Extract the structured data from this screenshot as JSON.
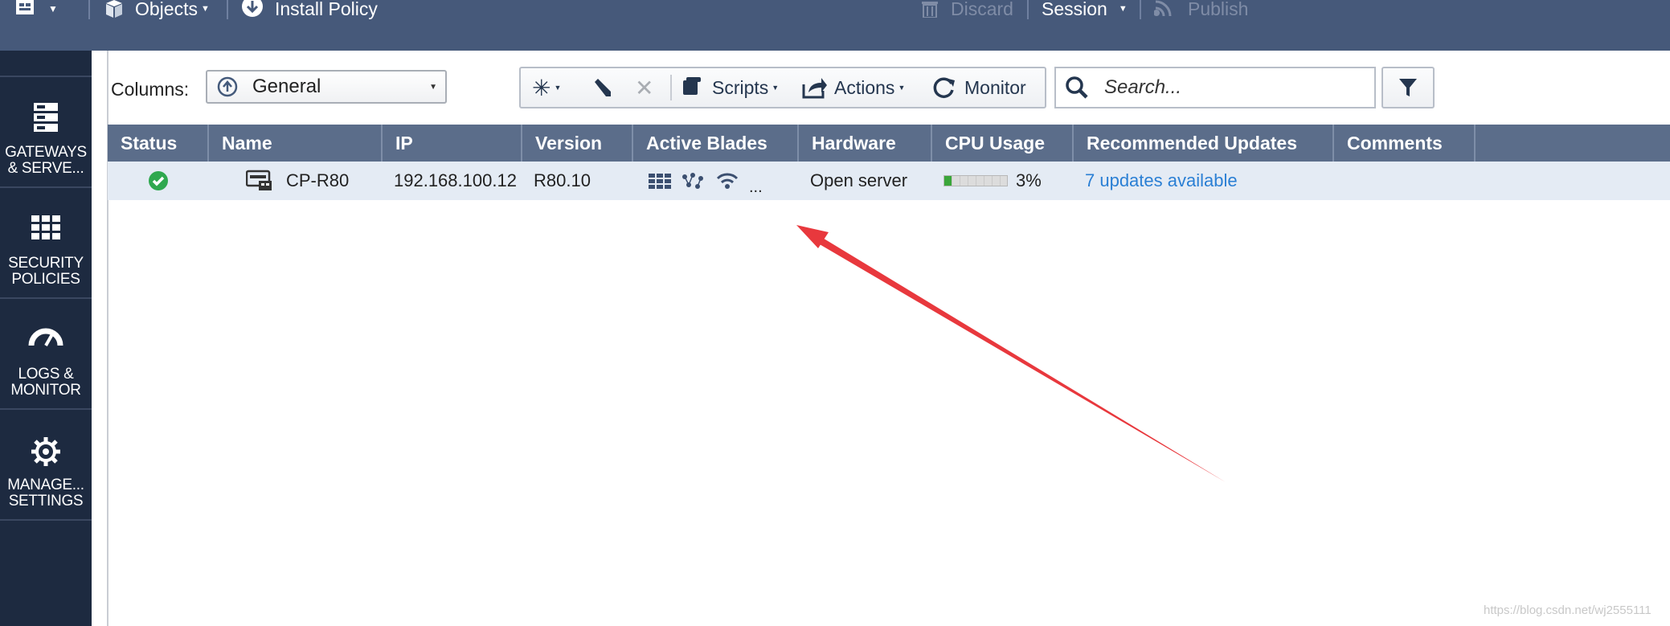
{
  "topbar": {
    "objects_label": "Objects",
    "install_policy_label": "Install Policy",
    "discard_label": "Discard",
    "session_label": "Session",
    "publish_label": "Publish"
  },
  "sidebar": {
    "items": [
      {
        "label": "GATEWAYS\n& SERVE...",
        "icon": "gateways-icon"
      },
      {
        "label": "SECURITY\nPOLICIES",
        "icon": "firewall-icon"
      },
      {
        "label": "LOGS &\nMONITOR",
        "icon": "gauge-icon"
      },
      {
        "label": "MANAGE...\nSETTINGS",
        "icon": "gear-icon"
      }
    ]
  },
  "toolbar": {
    "columns_label": "Columns:",
    "columns_value": "General",
    "scripts_label": "Scripts",
    "actions_label": "Actions",
    "monitor_label": "Monitor",
    "search_placeholder": "Search..."
  },
  "table": {
    "headers": [
      "Status",
      "Name",
      "IP",
      "Version",
      "Active Blades",
      "Hardware",
      "CPU Usage",
      "Recommended Updates",
      "Comments"
    ],
    "rows": [
      {
        "name": "CP-R80",
        "ip": "192.168.100.12",
        "version": "R80.10",
        "blades_more": "...",
        "hardware": "Open server",
        "cpu": "3%",
        "cpu_fraction": 0.03,
        "updates": "7 updates available",
        "comments": ""
      }
    ]
  },
  "watermark": "https://blog.csdn.net/wj2555111",
  "colors": {
    "topbar": "#46597a",
    "sidebar": "#1d2a40",
    "table_header": "#5b6d8a",
    "row_selected": "#e4ebf4",
    "link": "#2a7fd4",
    "status_ok": "#2fa84f",
    "annotation_arrow": "#e8383d"
  }
}
